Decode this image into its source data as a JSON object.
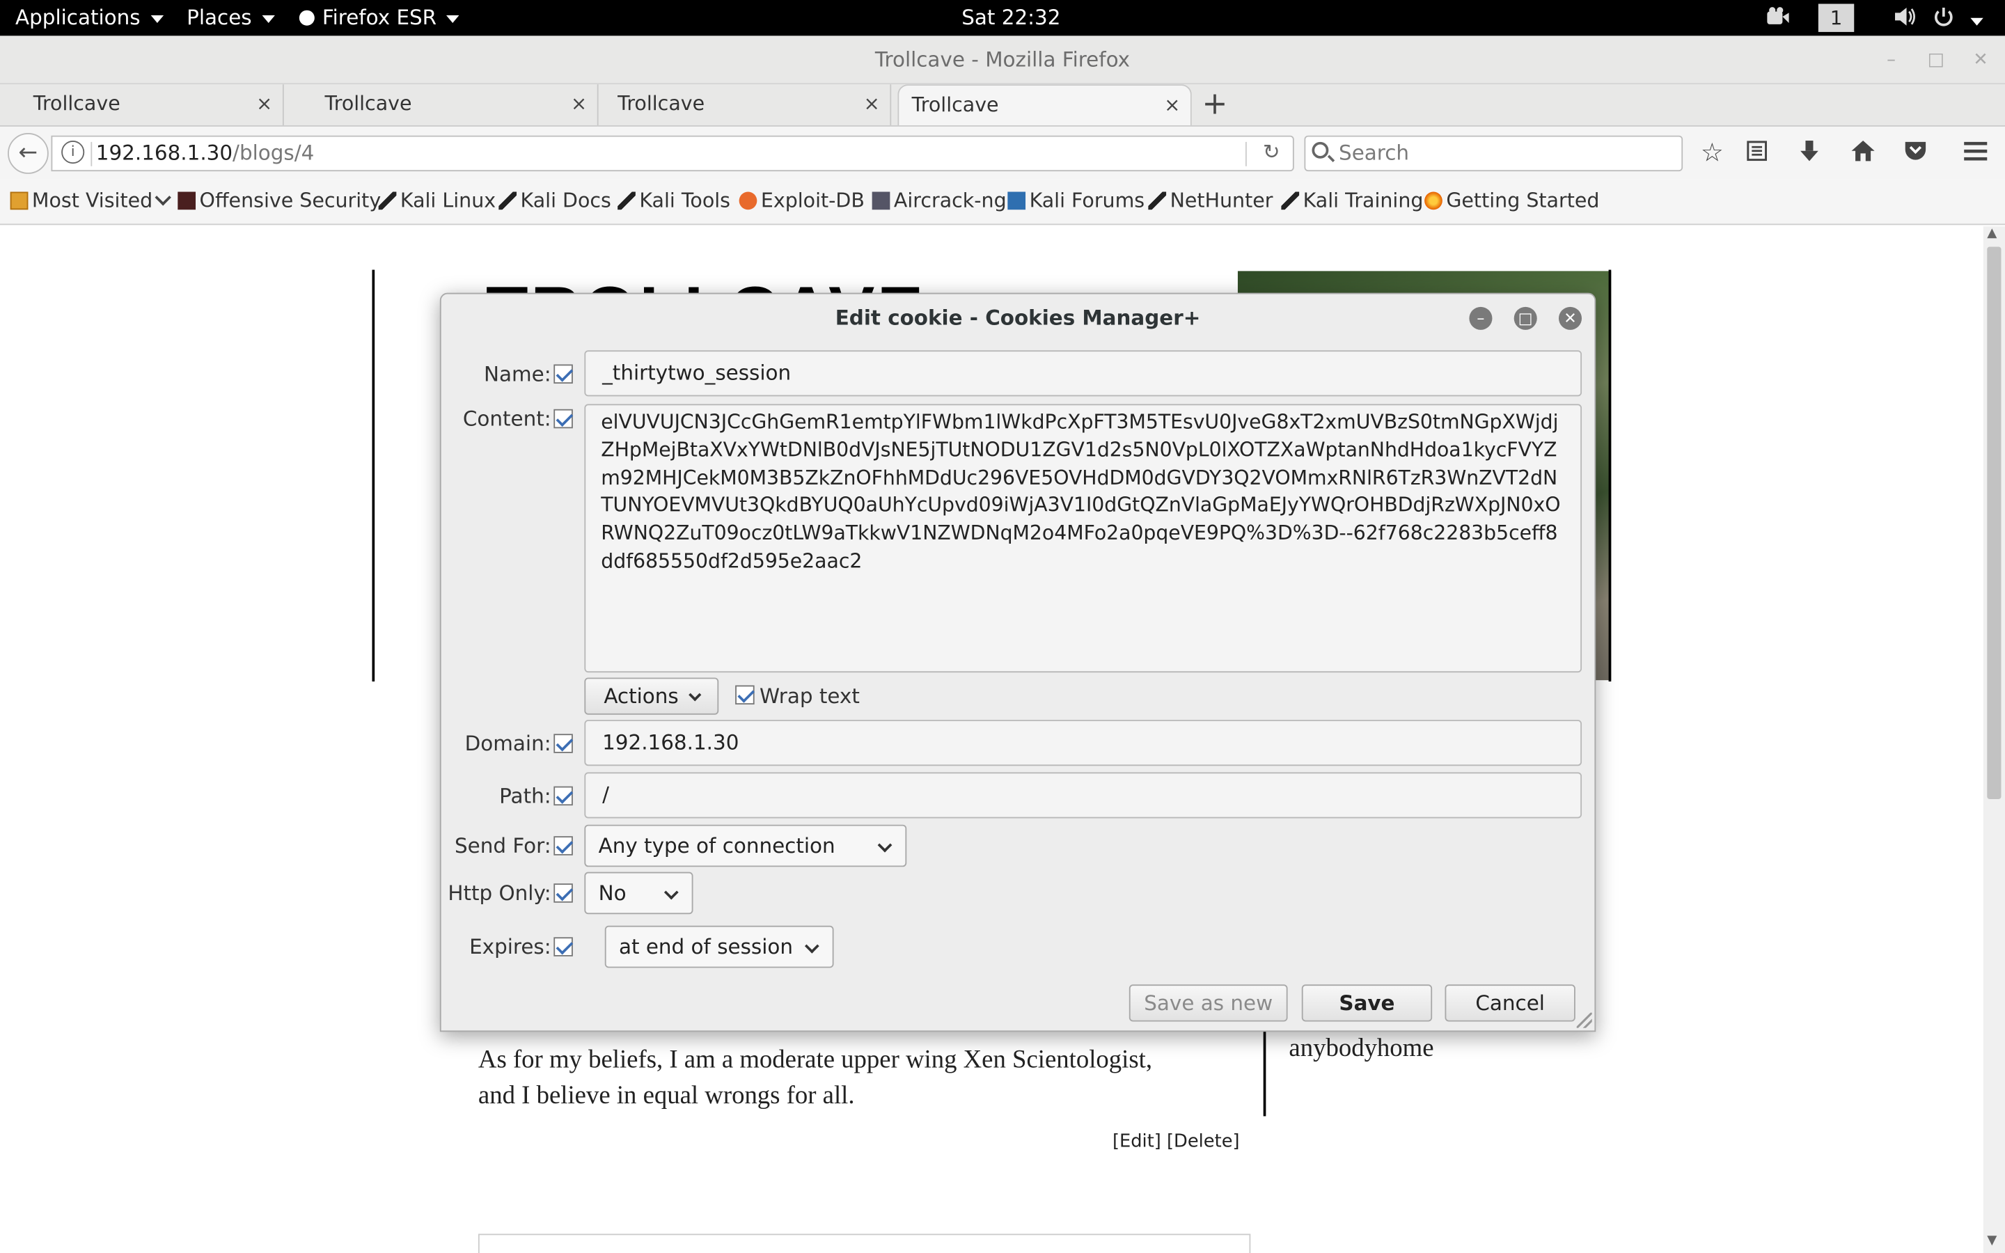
{
  "system_bar": {
    "applications": "Applications",
    "places": "Places",
    "firefox": "Firefox ESR",
    "clock": "Sat 22:32",
    "workspace": "1"
  },
  "window": {
    "title": "Trollcave - Mozilla Firefox"
  },
  "tabs": [
    {
      "label": "Trollcave",
      "close": "×"
    },
    {
      "label": "Trollcave",
      "close": "×"
    },
    {
      "label": "Trollcave",
      "close": "×"
    },
    {
      "label": "Trollcave",
      "close": "×",
      "active": true
    }
  ],
  "navbar": {
    "url_host": "192.168.1.30",
    "url_path": "/blogs/4",
    "search_placeholder": "Search"
  },
  "bookmarks": [
    {
      "label": "Most Visited",
      "icon": "folder-icon"
    },
    {
      "label": "Offensive Security",
      "icon": "offsec-icon"
    },
    {
      "label": "Kali Linux",
      "icon": "kali-icon"
    },
    {
      "label": "Kali Docs",
      "icon": "kali-icon"
    },
    {
      "label": "Kali Tools",
      "icon": "kali-icon"
    },
    {
      "label": "Exploit-DB",
      "icon": "exploitdb-icon"
    },
    {
      "label": "Aircrack-ng",
      "icon": "aircrack-icon"
    },
    {
      "label": "Kali Forums",
      "icon": "forums-icon"
    },
    {
      "label": "NetHunter",
      "icon": "kali-icon"
    },
    {
      "label": "Kali Training",
      "icon": "kali-icon"
    },
    {
      "label": "Getting Started",
      "icon": "firefox-icon"
    }
  ],
  "page": {
    "heading_partial": "TROLLCAVE",
    "paragraph": "As for my beliefs, I am a moderate upper wing Xen Scientologist, and I believe in equal wrongs for all.",
    "username": "anybodyhome",
    "edit_delete": "[Edit] [Delete]"
  },
  "dialog": {
    "title": "Edit cookie - Cookies Manager+",
    "name_label": "Name:",
    "name_value": "_thirtytwo_session",
    "content_label": "Content:",
    "content_value": "elVUVUJCN3JCcGhGemR1emtpYlFWbm1lWkdPcXpFT3M5TEsvU0JveG8xT2xmUVBzS0tmNGpXWjdjZHpMejBtaXVxYWtDNlB0dVJsNE5jTUtNODU1ZGV1d2s5N0VpL0lXOTZXaWptanNhdHdoa1kycFVYZm92MHJCekM0M3B5ZkZnOFhhMDdUc296VE5OVHdDM0dGVDY3Q2VOMmxRNlR6TzR3WnZVT2dNTUNYOEVMVUt3QkdBYUQ0aUhYcUpvd09iWjA3V1I0dGtQZnVlaGpMaEJyYWQrOHBDdjRzWXpJN0xORWNQ2ZuT09ocz0tLW9aTkkwV1NZWDNqM2o4MFo2a0pqeVE9PQ%3D%3D--62f768c2283b5ceff8ddf685550df2d595e2aac2",
    "actions_label": "Actions",
    "wrap_text_label": "Wrap text",
    "domain_label": "Domain:",
    "domain_value": "192.168.1.30",
    "path_label": "Path:",
    "path_value": "/",
    "send_for_label": "Send For:",
    "send_for_value": "Any type of connection",
    "http_only_label": "Http Only:",
    "http_only_value": "No",
    "expires_label": "Expires:",
    "expires_value": "at end of session",
    "save_as_new": "Save as new",
    "save": "Save",
    "cancel": "Cancel"
  },
  "colors": {
    "accent_check": "#3c6eb4",
    "topbar": "#000000"
  }
}
